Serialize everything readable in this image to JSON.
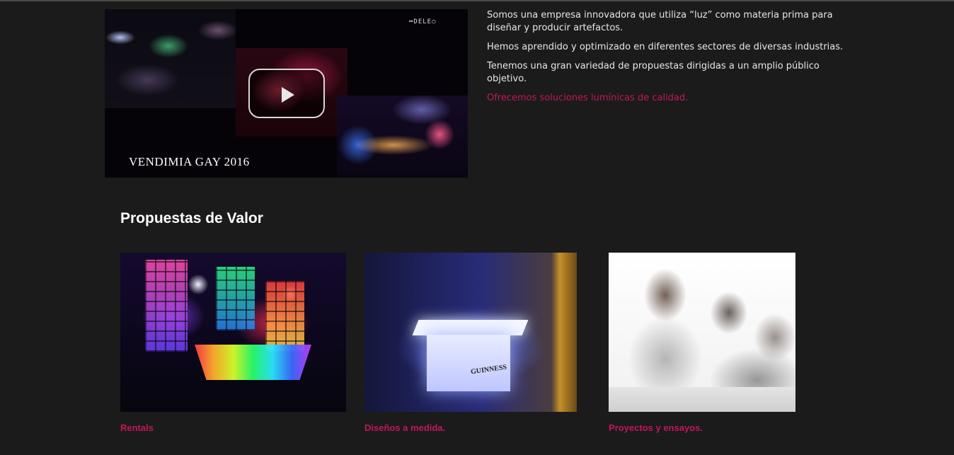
{
  "video": {
    "caption": "VENDIMIA GAY 2016",
    "watermark": "═DELE○",
    "play_icon": "play-icon"
  },
  "intro": {
    "p1": "Somos una empresa innovadora que utiliza “luz” como materia prima para diseñar y producir artefactos.",
    "p2": "Hemos aprendido y optimizado en diferentes sectores de diversas industrias.",
    "p3": "Tenemos una gran variedad de propuestas dirigidas a un amplio público objetivo.",
    "p4": "Ofrecemos soluciones lumínicas de calidad."
  },
  "section": {
    "title": "Propuestas de Valor"
  },
  "cards": [
    {
      "label": "Rentals",
      "brand": ""
    },
    {
      "label": "Diseños a medida.",
      "brand": "GUINNESS"
    },
    {
      "label": "Proyectos y ensayos.",
      "brand": ""
    }
  ],
  "colors": {
    "background": "#1b1b1b",
    "accent": "#c2175b",
    "text": "#e6e6e6"
  }
}
